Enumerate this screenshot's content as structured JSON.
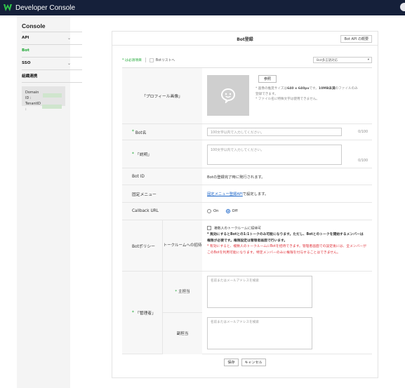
{
  "header": {
    "app_title": "Developer Console",
    "logo_icon": "w-logo-icon"
  },
  "sidebar": {
    "title": "Console",
    "items": [
      {
        "label": "API",
        "has_chevron": true,
        "active": false
      },
      {
        "label": "Bot",
        "has_chevron": false,
        "active": true
      },
      {
        "label": "SSO",
        "has_chevron": true,
        "active": false
      },
      {
        "label": "組織連携",
        "has_chevron": false,
        "active": false
      }
    ],
    "domain_label": "Domain ID :",
    "tenant_label": "TenantID :"
  },
  "card": {
    "title": "Bot登録",
    "api_button": "Bot API の概要",
    "required_note": "* は必須項目",
    "back_link": "Botリストへ",
    "language_select": "Bot多言語対応"
  },
  "form": {
    "profile": {
      "label": "「プロフィール画像」",
      "browse_button": "参照",
      "note1_pre": "* 画像の推奨サイズは",
      "note1_size": "640 x 640px",
      "note1_mid": "です。",
      "note1_limit": "10MB未満",
      "note1_post": "のファイルのみ登録できます。",
      "note2": "* ファイル名に特殊文字は使用できません。"
    },
    "bot_name": {
      "label": "Bot名",
      "placeholder": "100文字以内で入力してください。",
      "counter": "0/100"
    },
    "description": {
      "label": "「説明」",
      "placeholder": "100文字以内で入力してください。",
      "counter": "0/100"
    },
    "bot_id": {
      "label": "Bot ID",
      "value": "Botの登録完了時に発行されます。"
    },
    "fixed_menu": {
      "label": "固定メニュー",
      "link": "固定メニュー登録API",
      "suffix": " で設定します。"
    },
    "callback": {
      "label": "Callback URL",
      "on": "On",
      "off": "Off",
      "selected": "Off"
    },
    "policy": {
      "label": "Botポリシー",
      "sublabel": "トークルームへの招待",
      "checkbox": "複数人のトークルームに招待可",
      "line1": "* 無効にするとBotとの1:1トークのみ可能になります。ただし、Botとのトークを開始するメンバーは権限が必要です。権限設定は管理者画面で行います。",
      "line2": "* 有効にすると、複数人のトークルームにBotを招待できます。管理者画面での設定後には、全メンバーがこのBotを利用可能になります。特定メンバーのみに権限を付与することはできません。"
    },
    "manager": {
      "label": "「管理者」",
      "primary_label": "主担当",
      "secondary_label": "副担当",
      "search_placeholder": "名前またはメールアドレスを検索"
    }
  },
  "actions": {
    "save": "保存",
    "cancel": "キャンセル"
  },
  "colors": {
    "topbar": "#15203a",
    "accent_green": "#1ba632",
    "link_blue": "#1a64c8",
    "warning_red": "#e0343c"
  }
}
